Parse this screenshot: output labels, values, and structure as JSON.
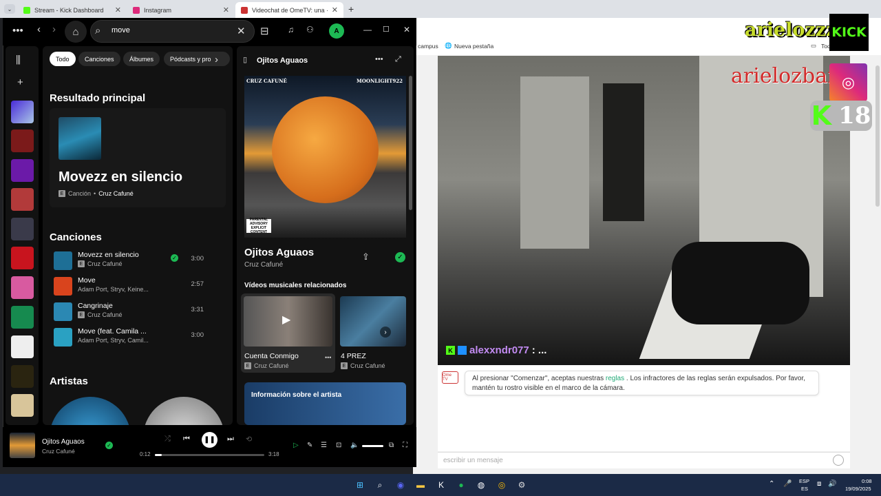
{
  "browser": {
    "tabs": [
      {
        "label": "Stream - Kick Dashboard",
        "color": "#53fc18"
      },
      {
        "label": "Instagram",
        "color": "#dd2a7b"
      },
      {
        "label": "Videochat de OmeTV: una ·",
        "color": "#c33"
      }
    ],
    "new_tab": "+",
    "bookmarks": [
      "campus",
      "Nueva pestaña",
      "Tod"
    ]
  },
  "overlay": {
    "kick_user": "arielozzz",
    "kick_logo": "KICK",
    "ig_user": "arielozban",
    "age_badge": "18"
  },
  "ometv": {
    "chat_user": "alexxndr077",
    "chat_msg": ":  ...",
    "rules_pre": "Al presionar \"Comenzar\", aceptas nuestras ",
    "rules_link": "reglas",
    "rules_post": " . Los infractores de las reglas serán expulsados. Por favor, mantén tu rostro visible en el marco de la cámara.",
    "badge": "Ome TV",
    "input_placeholder": "escribir un mensaje"
  },
  "spotify": {
    "search_value": "move",
    "avatar": "A",
    "chips": [
      "Todo",
      "Canciones",
      "Álbumes",
      "Pódcasts y pro"
    ],
    "top_result": {
      "heading": "Resultado principal",
      "title": "Movezz en silencio",
      "type": "Canción",
      "artist": "Cruz Cafuné",
      "explicit": "E"
    },
    "songs_heading": "Canciones",
    "songs": [
      {
        "title": "Movezz en silencio",
        "artist": "Cruz Cafuné",
        "explicit": true,
        "duration": "3:00",
        "saved": true,
        "color": "#1e6f96"
      },
      {
        "title": "Move",
        "artist": "Adam Port, Stryv, Keine...",
        "explicit": false,
        "duration": "2:57",
        "saved": false,
        "color": "#d9441d"
      },
      {
        "title": "Cangrinaje",
        "artist": "Cruz Cafuné",
        "explicit": true,
        "duration": "3:31",
        "saved": false,
        "color": "#2b88b3"
      },
      {
        "title": "Move (feat. Camila ...",
        "artist": "Adam Port, Stryv, Camil...",
        "explicit": false,
        "duration": "3:00",
        "saved": false,
        "color": "#2aa1c2"
      }
    ],
    "artists_heading": "Artistas",
    "now_playing_panel": {
      "header": "Ojitos Aguaos",
      "cover_left": "CRUZ CAFUNÉ",
      "cover_right": "MOONLIGHT922",
      "advisory": "PARENTAL ADVISORY EXPLICIT CONTENT",
      "title": "Ojitos Aguaos",
      "artist": "Cruz Cafuné",
      "related_heading": "Vídeos musicales relacionados",
      "videos": [
        {
          "title": "Cuenta Conmigo",
          "artist": "Cruz Cafuné"
        },
        {
          "title": "4 PREZ",
          "artist": "Cruz Cafuné"
        }
      ],
      "artist_info": "Información sobre el artista"
    },
    "player": {
      "title": "Ojitos Aguaos",
      "artist": "Cruz Cafuné",
      "elapsed": "0:12",
      "total": "3:18",
      "progress": 0.06
    }
  },
  "taskbar": {
    "lang": "ESP",
    "region": "ES",
    "time": "0:08",
    "date": "19/09/2025"
  }
}
